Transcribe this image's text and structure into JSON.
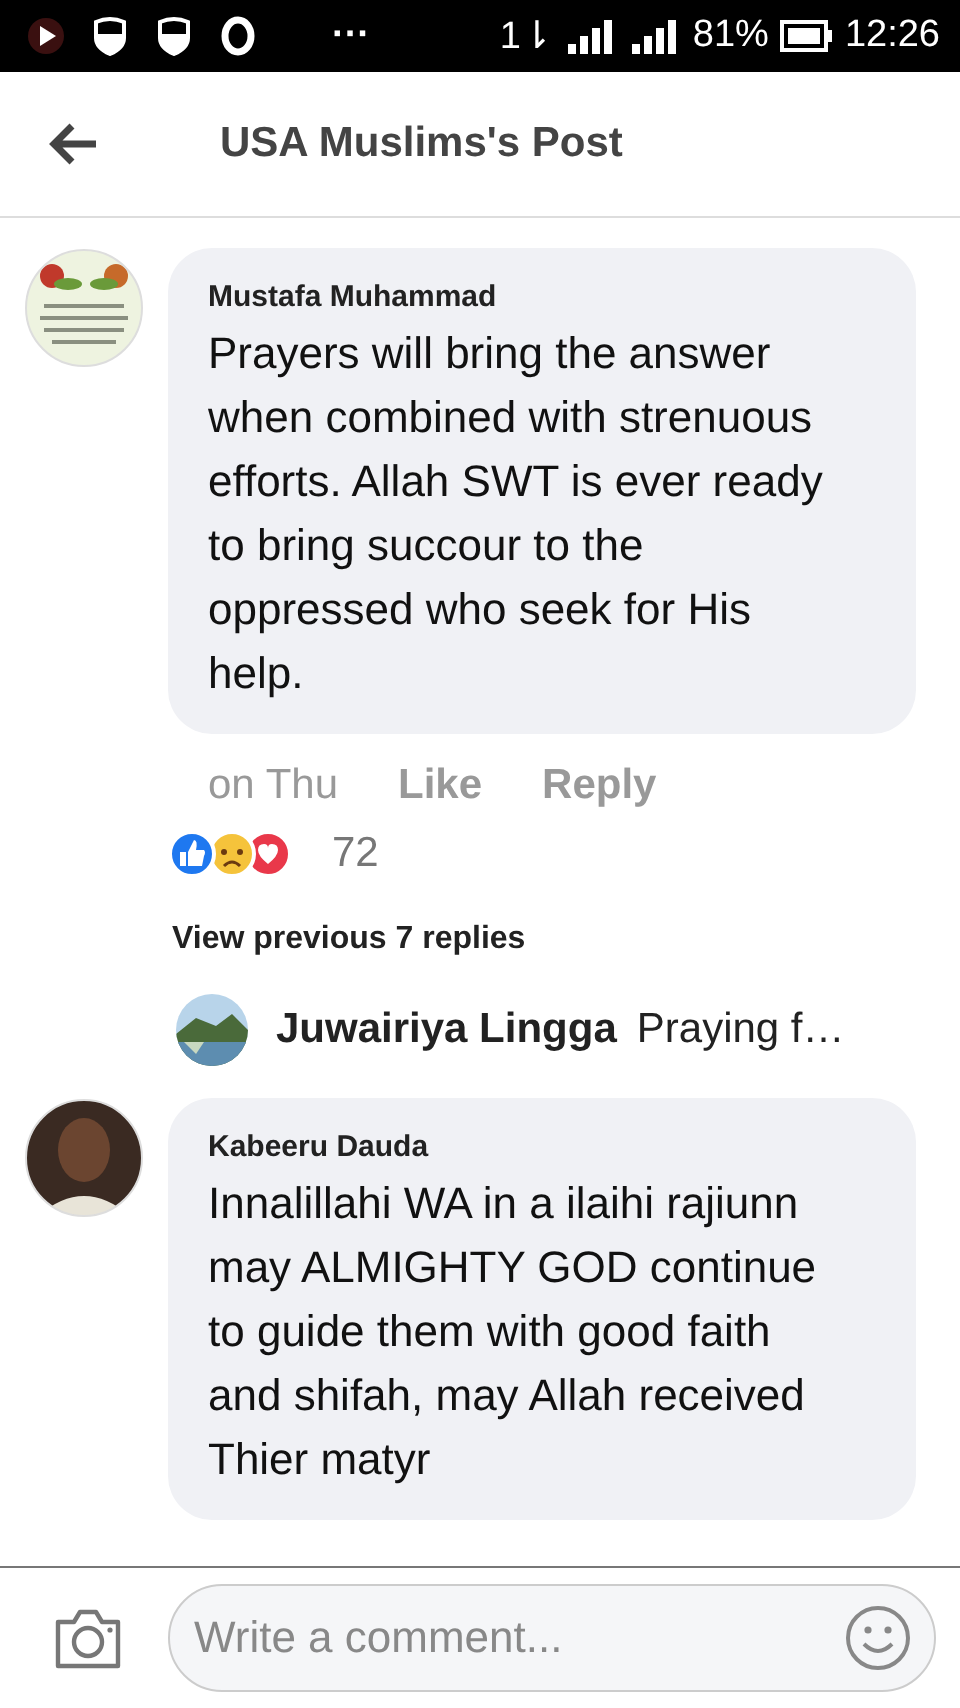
{
  "status_bar": {
    "dots": "···",
    "network": "1⇂",
    "battery_percent": "81%",
    "time": "12:26"
  },
  "header": {
    "title": "USA Muslims's Post"
  },
  "comments": [
    {
      "author": "Mustafa Muhammad",
      "text": "Prayers will bring the answer when combined with strenuous efforts. Allah SWT is ever ready to bring succour to the oppressed who seek for His help.",
      "time": "on Thu",
      "actions": [
        "Like",
        "Reply"
      ],
      "reaction_count": "72",
      "view_previous": "View previous 7 replies",
      "reply_preview": {
        "author": "Juwairiya Lingga",
        "text": "Praying f…"
      }
    },
    {
      "avatar": {
        "kind": "person"
      },
      "author": "Kabeeru Dauda",
      "text": "Innalillahi WA in a ilaihi rajiunn may ALMIGHTY GOD continue to guide them with good faith and shifah, may Allah received Thier matyr"
    }
  ],
  "composer": {
    "placeholder": "Write a comment..."
  }
}
